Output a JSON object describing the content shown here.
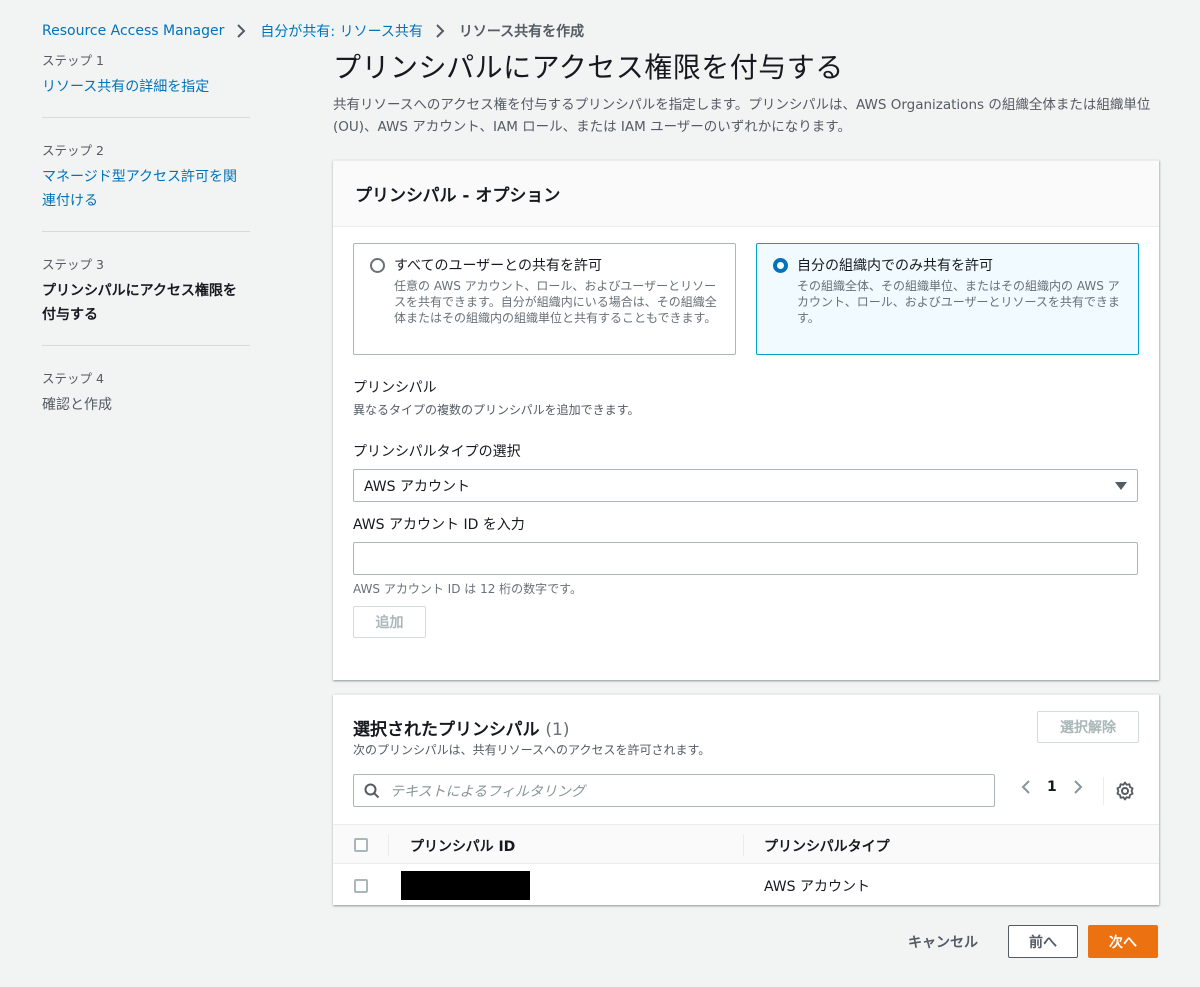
{
  "breadcrumb": {
    "items": [
      "Resource Access Manager",
      "自分が共有: リソース共有",
      "リソース共有を作成"
    ]
  },
  "steps": [
    {
      "num": "ステップ 1",
      "title": "リソース共有の詳細を指定"
    },
    {
      "num": "ステップ 2",
      "title": "マネージド型アクセス許可を関連付ける"
    },
    {
      "num": "ステップ 3",
      "title": "プリンシパルにアクセス権限を付与する"
    },
    {
      "num": "ステップ 4",
      "title": "確認と作成"
    }
  ],
  "main": {
    "title": "プリンシパルにアクセス権限を付与する",
    "description": "共有リソースへのアクセス権を付与するプリンシパルを指定します。プリンシパルは、AWS Organizations の組織全体または組織単位 (OU)、AWS アカウント、IAM ロール、または IAM ユーザーのいずれかになります。"
  },
  "options_panel": {
    "header": "プリンシパル - オプション",
    "tiles": [
      {
        "title": "すべてのユーザーとの共有を許可",
        "desc": "任意の AWS アカウント、ロール、およびユーザーとリソースを共有できます。自分が組織内にいる場合は、その組織全体またはその組織内の組織単位と共有することもできます。",
        "selected": false
      },
      {
        "title": "自分の組織内でのみ共有を許可",
        "desc": "その組織全体、その組織単位、またはその組織内の AWS アカウント、ロール、およびユーザーとリソースを共有できます。",
        "selected": true
      }
    ],
    "principal_label": "プリンシパル",
    "principal_desc": "異なるタイプの複数のプリンシパルを追加できます。",
    "type_label": "プリンシパルタイプの選択",
    "type_value": "AWS アカウント",
    "account_label": "AWS アカウント ID を入力",
    "account_value": "",
    "account_hint": "AWS アカウント ID は 12 桁の数字です。",
    "add_button": "追加"
  },
  "selected_panel": {
    "title": "選択されたプリンシパル",
    "count": "(1)",
    "desc": "次のプリンシパルは、共有リソースへのアクセスを許可されます。",
    "clear_button": "選択解除",
    "filter_placeholder": "テキストによるフィルタリング",
    "page": "1",
    "columns": [
      "プリンシパル ID",
      "プリンシパルタイプ"
    ],
    "rows": [
      {
        "type": "AWS アカウント"
      }
    ]
  },
  "footer": {
    "cancel": "キャンセル",
    "prev": "前へ",
    "next": "次へ"
  }
}
